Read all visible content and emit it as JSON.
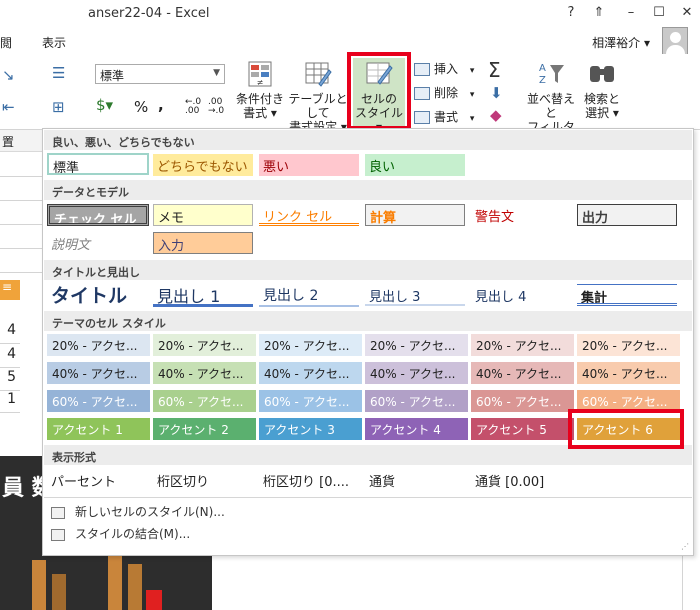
{
  "window": {
    "title": "anser22-04 - Excel",
    "controls": [
      "?",
      "⇑",
      "–",
      "☐",
      "✕"
    ]
  },
  "menu": {
    "tabs": [
      "閲",
      "表示"
    ],
    "user": "相澤裕介 ▾"
  },
  "ribbon": {
    "number_format": "標準",
    "number_symbols": {
      "percent": "%",
      "comma": ",",
      "inc_decimal": "←.00 .0",
      "dec_decimal": ".00 →.0"
    },
    "buttons": {
      "conditional": [
        "条件付き",
        "書式 ▾"
      ],
      "table": [
        "テーブルとして",
        "書式設定 ▾"
      ],
      "cellstyle": [
        "セルの",
        "スタイル ▾"
      ],
      "insert": "挿入",
      "delete": "削除",
      "format": "書式",
      "sort": [
        "並べ替えと",
        "フィルター ▾"
      ],
      "find": [
        "検索と",
        "選択 ▾"
      ]
    }
  },
  "sheet_left": {
    "label_oki": "置",
    "rows": [
      "4",
      "4",
      "5",
      "1"
    ],
    "chart_text": "員 数"
  },
  "gallery": {
    "sections": {
      "goodbad": "良い、悪い、どちらでもない",
      "data": "データとモデル",
      "titles": "タイトルと見出し",
      "theme": "テーマのセル スタイル",
      "numfmt": "表示形式"
    },
    "goodbad": [
      "標準",
      "どちらでもない",
      "悪い",
      "良い"
    ],
    "data_row1": [
      "チェック セル",
      "メモ",
      "リンク セル",
      "計算",
      "警告文",
      "出力"
    ],
    "data_row2": [
      "説明文",
      "入力"
    ],
    "titles": [
      "タイトル",
      "見出し 1",
      "見出し 2",
      "見出し 3",
      "見出し 4",
      "集計"
    ],
    "theme_20": "20% - アクセ...",
    "theme_40": "40% - アクセ...",
    "theme_60": "60% - アクセ...",
    "accents": [
      "アクセント 1",
      "アクセント 2",
      "アクセント 3",
      "アクセント 4",
      "アクセント 5",
      "アクセント 6"
    ],
    "numfmts": [
      "パーセント",
      "桁区切り",
      "桁区切り [0....",
      "通貨",
      "通貨 [0.00]"
    ],
    "menu": [
      "新しいセルのスタイル(N)...",
      "スタイルの結合(M)..."
    ]
  },
  "colors": {
    "accent_highlight": "#e8001c",
    "theme20": [
      "#dce6f1",
      "#e2efda",
      "#ddebf7",
      "#e4dfec",
      "#f2dcdb",
      "#fce4d6"
    ],
    "theme40": [
      "#b8cce4",
      "#c6e0b4",
      "#bdd7ee",
      "#ccc0da",
      "#e6b8b7",
      "#f8cbad"
    ],
    "theme60": [
      "#95b3d7",
      "#a9d08e",
      "#9bc2e6",
      "#b1a0c7",
      "#da9694",
      "#f4b084"
    ],
    "accent": [
      "#8fc45a",
      "#5bb06f",
      "#4a9fd1",
      "#8e63b6",
      "#c4506b",
      "#e0a13a"
    ]
  }
}
